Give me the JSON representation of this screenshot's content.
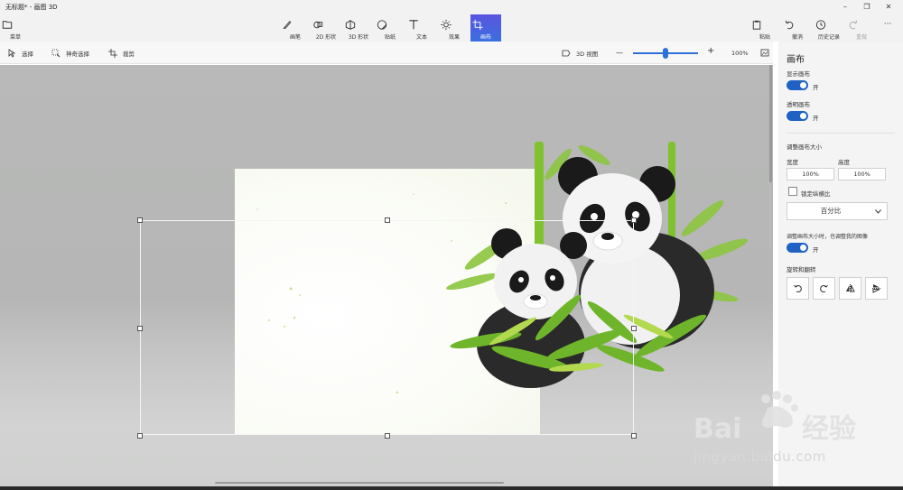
{
  "window": {
    "title": "无标题* - 画图 3D",
    "minimize": "–",
    "restore": "❐",
    "close": "✕"
  },
  "ribbon": {
    "menu": "菜单",
    "tools": [
      {
        "label": "画笔",
        "icon": "brush-icon"
      },
      {
        "label": "2D 形状",
        "icon": "2d-shapes-icon"
      },
      {
        "label": "3D 形状",
        "icon": "3d-shapes-icon"
      },
      {
        "label": "贴纸",
        "icon": "sticker-icon"
      },
      {
        "label": "文本",
        "icon": "text-icon"
      },
      {
        "label": "效果",
        "icon": "effects-icon"
      },
      {
        "label": "画布",
        "icon": "canvas-icon"
      }
    ],
    "right": [
      {
        "label": "粘贴",
        "icon": "paste-icon"
      },
      {
        "label": "撤消",
        "icon": "undo-icon"
      },
      {
        "label": "历史记录",
        "icon": "history-icon"
      },
      {
        "label": "重做",
        "icon": "redo-icon"
      }
    ],
    "more": "···"
  },
  "toolbar": {
    "select": "选择",
    "magic_select": "神奇选择",
    "crop": "裁剪",
    "view3d": "3D 视图",
    "zoom_minus": "—",
    "zoom_plus": "+",
    "zoom_level": "100%",
    "zoom_fraction": 0.47
  },
  "panel": {
    "title": "画布",
    "show_canvas": "显示画布",
    "show_canvas_state": "开",
    "transparent_canvas": "透明画布",
    "transparent_canvas_state": "开",
    "resize_heading": "调整画布大小",
    "width_label": "宽度",
    "height_label": "高度",
    "width_value": "100%",
    "height_value": "100%",
    "lock_aspect": "锁定纵横比",
    "unit": "百分比",
    "resize_image": "调整画布大小时，也调整我的图像",
    "resize_image_state": "开",
    "rotate_heading": "旋转和翻转"
  },
  "watermark": {
    "text": "jingyan.baidu.com"
  },
  "colors": {
    "accent": "#1f62c4",
    "active_tab": "#4a60e0",
    "bamboo": "#7fbf2a"
  }
}
